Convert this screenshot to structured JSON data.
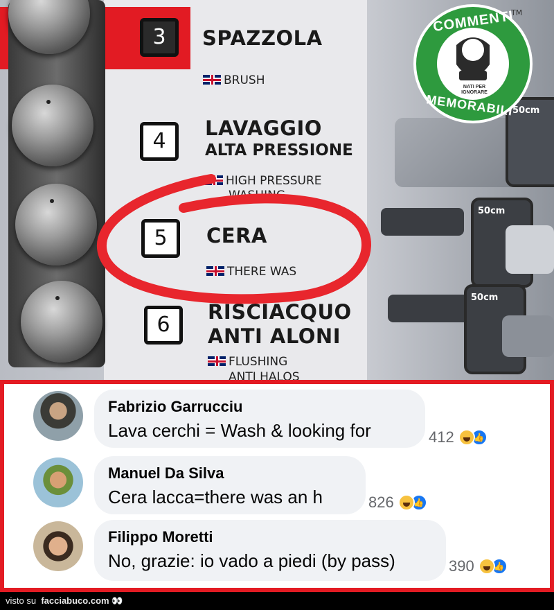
{
  "photo": {
    "trademark": "TM",
    "rows": [
      {
        "number": "3",
        "title": "SPAZZOLA",
        "subtitle": "",
        "english": "BRUSH"
      },
      {
        "number": "4",
        "title": "LAVAGGIO",
        "subtitle": "ALTA PRESSIONE",
        "english": "HIGH PRESSURE"
      },
      {
        "number": "5",
        "title": "CERA",
        "subtitle": "",
        "english": "THERE WAS"
      },
      {
        "number": "6",
        "title": "RISCIACQUO",
        "subtitle": "ANTI ALONI",
        "english": "FLUSHING"
      }
    ],
    "row4_english_cut": "WASHING",
    "row6_english_cut": "ANTI HALOS",
    "distance_labels": [
      "50cm",
      "50cm",
      "50cm"
    ],
    "logo": {
      "top_text": "COMMENTI",
      "bottom_text": "MEMORABILI",
      "small_text": "NATI PER IGNORARE"
    },
    "colors": {
      "red_band": "#e21b23",
      "highlight_circle": "#e8262d"
    }
  },
  "comments": [
    {
      "author": "Fabrizio Garrucciu",
      "text": "Lava cerchi = Wash & looking for",
      "reactions": "412"
    },
    {
      "author": "Manuel Da Silva",
      "text": "Cera lacca=there was an h",
      "reactions": "826"
    },
    {
      "author": "Filippo Moretti",
      "text": "No, grazie: io vado a piedi (by pass)",
      "reactions": "390"
    }
  ],
  "footer": {
    "prefix": "visto su",
    "site": "facciabuco.com"
  },
  "colors": {
    "border_red": "#e31b23",
    "bubble_bg": "#f0f2f5",
    "like_blue": "#1877f2",
    "haha_yellow": "#f7c23f"
  }
}
